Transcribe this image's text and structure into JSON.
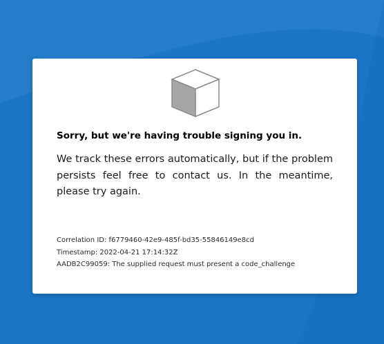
{
  "error": {
    "title": "Sorry, but we're having trouble signing you in.",
    "message": "We track these errors automatically, but if the problem persists feel free to contact us. In the meantime, please try again.",
    "details": {
      "correlation": "Correlation ID: f6779460-42e9-485f-bd35-55846149e8cd",
      "timestamp": "Timestamp: 2022-04-21 17:14:32Z",
      "code": "AADB2C99059: The supplied request must present a code_challenge"
    }
  },
  "icons": {
    "error_graphic": "cube-icon"
  },
  "colors": {
    "background": "#1b75c4",
    "card": "#ffffff",
    "cube_face": "#a6a6a6",
    "cube_outline": "#8a8a8a"
  }
}
